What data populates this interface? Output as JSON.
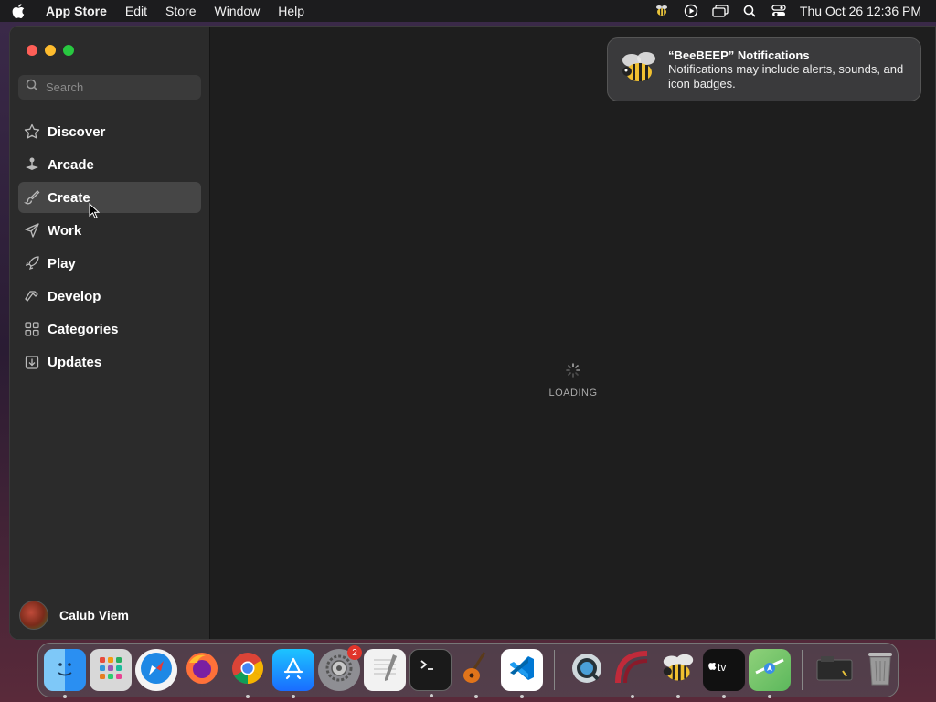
{
  "menubar": {
    "app_name": "App Store",
    "items": [
      "Edit",
      "Store",
      "Window",
      "Help"
    ],
    "clock": "Thu Oct 26  12:36 PM"
  },
  "search": {
    "placeholder": "Search"
  },
  "sidebar": {
    "items": [
      {
        "label": "Discover",
        "icon": "star-icon"
      },
      {
        "label": "Arcade",
        "icon": "joystick-icon"
      },
      {
        "label": "Create",
        "icon": "brush-icon",
        "active": true
      },
      {
        "label": "Work",
        "icon": "paper-plane-icon"
      },
      {
        "label": "Play",
        "icon": "rocket-icon"
      },
      {
        "label": "Develop",
        "icon": "hammer-icon"
      },
      {
        "label": "Categories",
        "icon": "grid-icon"
      },
      {
        "label": "Updates",
        "icon": "download-icon"
      }
    ],
    "user_name": "Calub Viem"
  },
  "main": {
    "loading_label": "LOADING"
  },
  "notification": {
    "title": "“BeeBEEP” Notifications",
    "body": "Notifications may include alerts, sounds, and icon badges."
  },
  "dock": {
    "apps": [
      {
        "name": "Finder",
        "color": "#2a8ff2"
      },
      {
        "name": "Launchpad",
        "color": "#d8d8d8"
      },
      {
        "name": "Safari",
        "color": "#1e88e5"
      },
      {
        "name": "Firefox",
        "color": "#ff7139"
      },
      {
        "name": "Chrome",
        "color": "#e8e8e8"
      },
      {
        "name": "App Store",
        "color": "#1a8cff"
      },
      {
        "name": "System Settings",
        "color": "#8e8e93",
        "badge": "2"
      },
      {
        "name": "TextEdit",
        "color": "#f2f2f2"
      },
      {
        "name": "Terminal",
        "color": "#1a1a1a"
      },
      {
        "name": "GarageBand",
        "color": "#e0741a"
      },
      {
        "name": "Visual Studio Code",
        "color": "#ffffff"
      },
      {
        "name": "QuickTime",
        "color": "#4aa0d8"
      },
      {
        "name": "Arc",
        "color": "#c02a3a"
      },
      {
        "name": "BeeBEEP",
        "color": "#e8c23a"
      },
      {
        "name": "TV",
        "color": "#111111"
      },
      {
        "name": "Maps",
        "color": "#5cb85c"
      },
      {
        "name": "Screenshots",
        "color": "#333333"
      },
      {
        "name": "Trash",
        "color": "#9a9a9a"
      }
    ]
  }
}
